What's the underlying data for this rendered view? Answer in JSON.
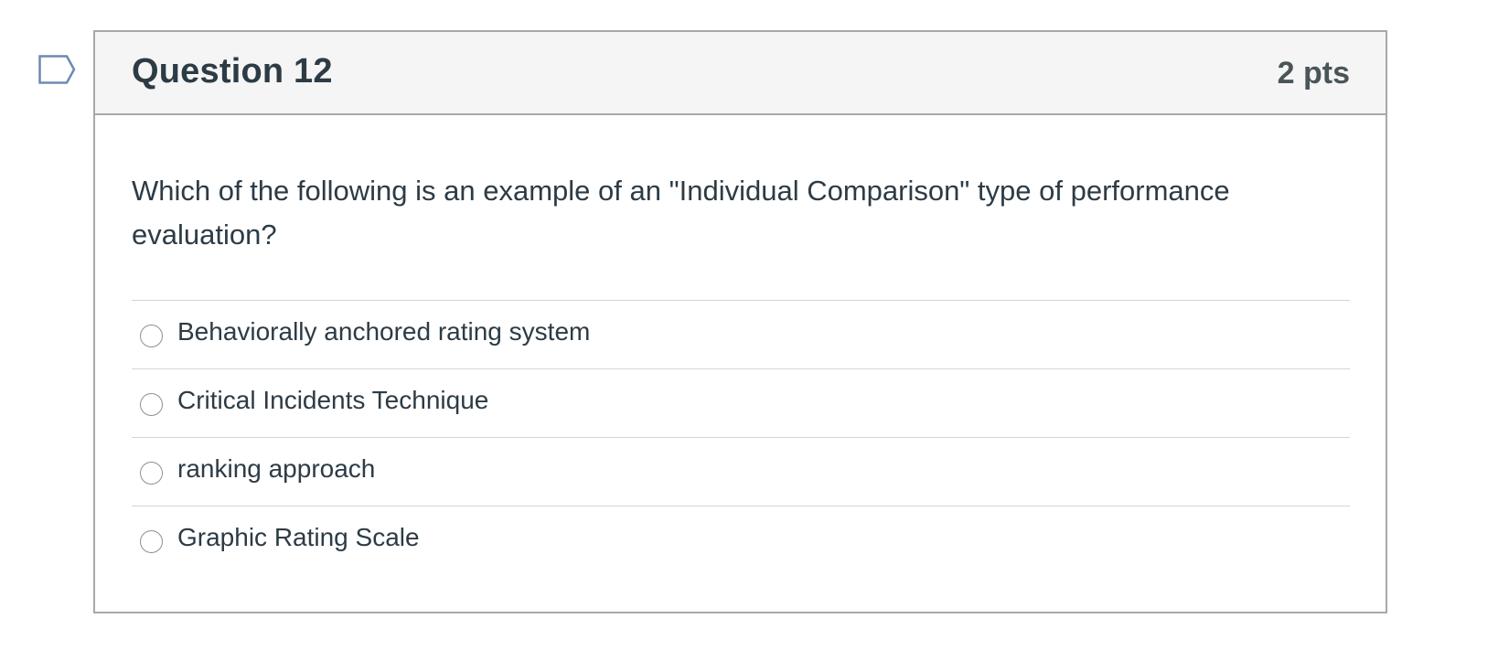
{
  "question": {
    "title": "Question 12",
    "points": "2 pts",
    "text": "Which of the following is an example of an \"Individual Comparison\" type of performance evaluation?",
    "flag_icon": "flag-outline-icon"
  },
  "answers": [
    {
      "label": "Behaviorally anchored rating system",
      "selected": false
    },
    {
      "label": "Critical Incidents Technique",
      "selected": false
    },
    {
      "label": "ranking approach",
      "selected": false
    },
    {
      "label": "Graphic Rating Scale",
      "selected": false
    }
  ],
  "colors": {
    "header_bg": "#f5f5f5",
    "border": "#a5a9ab",
    "text": "#2d3b45",
    "flag": "#6c8bb0"
  }
}
